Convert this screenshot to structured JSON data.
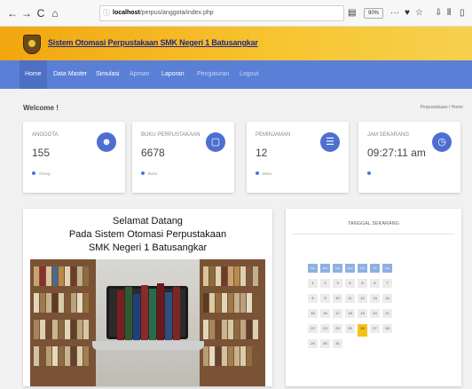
{
  "browser": {
    "back_icon": "←",
    "forward_icon": "→",
    "reload_icon": "C",
    "home_icon": "⌂",
    "url_prefix": "localhost",
    "url_path": "/perpus/anggota/index.php",
    "zoom": "90%",
    "more_icon": "···",
    "pocket_icon": "♥",
    "bookmark_icon": "☆",
    "download_icon": "⇩",
    "library_icon": "⫴",
    "sidebar_icon": "▯"
  },
  "header": {
    "title": "Sistem Otomasi Perpustakaan SMK Negeri 1 Batusangkar"
  },
  "menu": {
    "items": [
      {
        "label": "Home"
      },
      {
        "label": "Data Master"
      },
      {
        "label": "Simulasi"
      },
      {
        "label": "Aproan"
      },
      {
        "label": "Laporan"
      },
      {
        "label": "Pengaturan"
      },
      {
        "label": "Logout"
      }
    ]
  },
  "page": {
    "welcome": "Welcome !",
    "breadcrumb": "Perpustakaan  /  Home"
  },
  "cards": [
    {
      "label": "ANGGOTA",
      "value": "155",
      "footer": "Orang",
      "icon": "users-icon",
      "glyph": "☻"
    },
    {
      "label": "BUKU PERPUSTAKAAN",
      "value": "6678",
      "footer": "Buku",
      "icon": "book-icon",
      "glyph": "▢"
    },
    {
      "label": "PEMINJAMAN",
      "value": "12",
      "footer": "Buku",
      "icon": "list-icon",
      "glyph": "☰"
    },
    {
      "label": "JAM SEKARANG",
      "value": "09:27:11 am",
      "footer": "",
      "icon": "clock-icon",
      "glyph": "◷"
    }
  ],
  "welcome_panel": {
    "line1": "Selamat Datang",
    "line2": "Pada Sistem Otomasi Perpustakaan",
    "line3": "SMK Negeri 1 Batusangkar"
  },
  "calendar": {
    "title": "TANGGAL SEKARANG",
    "weekdays": [
      "Sun",
      "Mon",
      "Tue",
      "Wed",
      "Thu",
      "Fri",
      "Sat"
    ],
    "weeks": [
      [
        "",
        "1",
        "2",
        "3",
        "4",
        "5",
        "6",
        "7"
      ],
      [
        "",
        "8",
        "9",
        "10",
        "11",
        "12",
        "13",
        "14"
      ],
      [
        "",
        "15",
        "16",
        "17",
        "18",
        "19",
        "20",
        "21"
      ],
      [
        "",
        "22",
        "23",
        "24",
        "25",
        "26",
        "27",
        "28"
      ],
      [
        "",
        "29",
        "30",
        "31",
        "",
        "",
        "",
        ""
      ]
    ],
    "today": "26",
    "highlight_color": "#f4c21b",
    "header_color": "#8fb0e3"
  },
  "colors": {
    "accent": "#5a7fd6",
    "header_gold": "#f7c531",
    "icon_blue": "#4e6fd1"
  }
}
